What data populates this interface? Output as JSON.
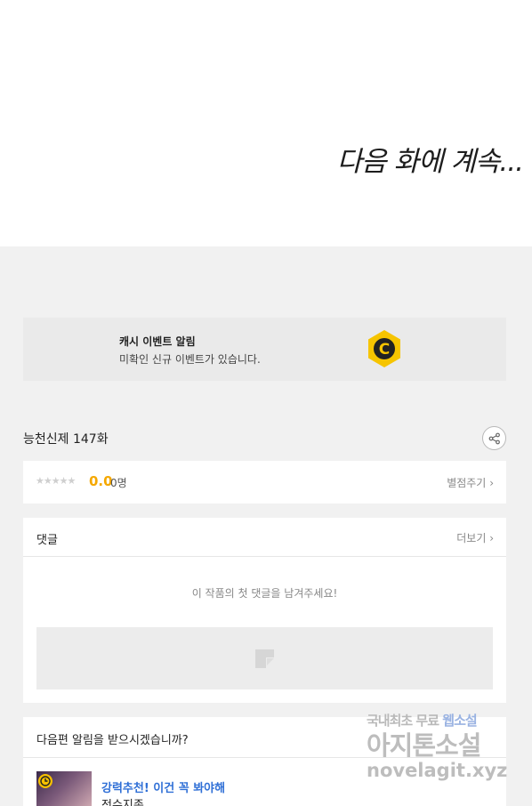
{
  "comic": {
    "to_be_continued": "다음 화에 계속..."
  },
  "event_banner": {
    "title": "캐시 이벤트 알림",
    "subtitle": "미확인 신규 이벤트가 있습니다.",
    "coin_letter": "C",
    "coin_color": "#f6c400"
  },
  "episode": {
    "title": "능천신제 147화",
    "share_icon": "share-icon"
  },
  "rating": {
    "stars": "★★★★★",
    "score": "0.0",
    "count": "0명",
    "rate_label": "별점주기",
    "accent_color": "#f5a800",
    "level": 0
  },
  "comments": {
    "title": "댓글",
    "more_label": "더보기",
    "empty_message": "이 작품의 첫 댓글을 남겨주세요!"
  },
  "notify": {
    "question": "다음편 알림을 받으시겠습니까?",
    "recommend_title": "강력추천! 이건 꼭 봐야해",
    "recommend_name": "전수지존",
    "link_color": "#2f6fd6"
  },
  "watermark": {
    "line1_a": "국내최초 무료",
    "line1_b": "웹소설",
    "line2": "아지톤소설",
    "line3": "novelagit.xyz"
  }
}
